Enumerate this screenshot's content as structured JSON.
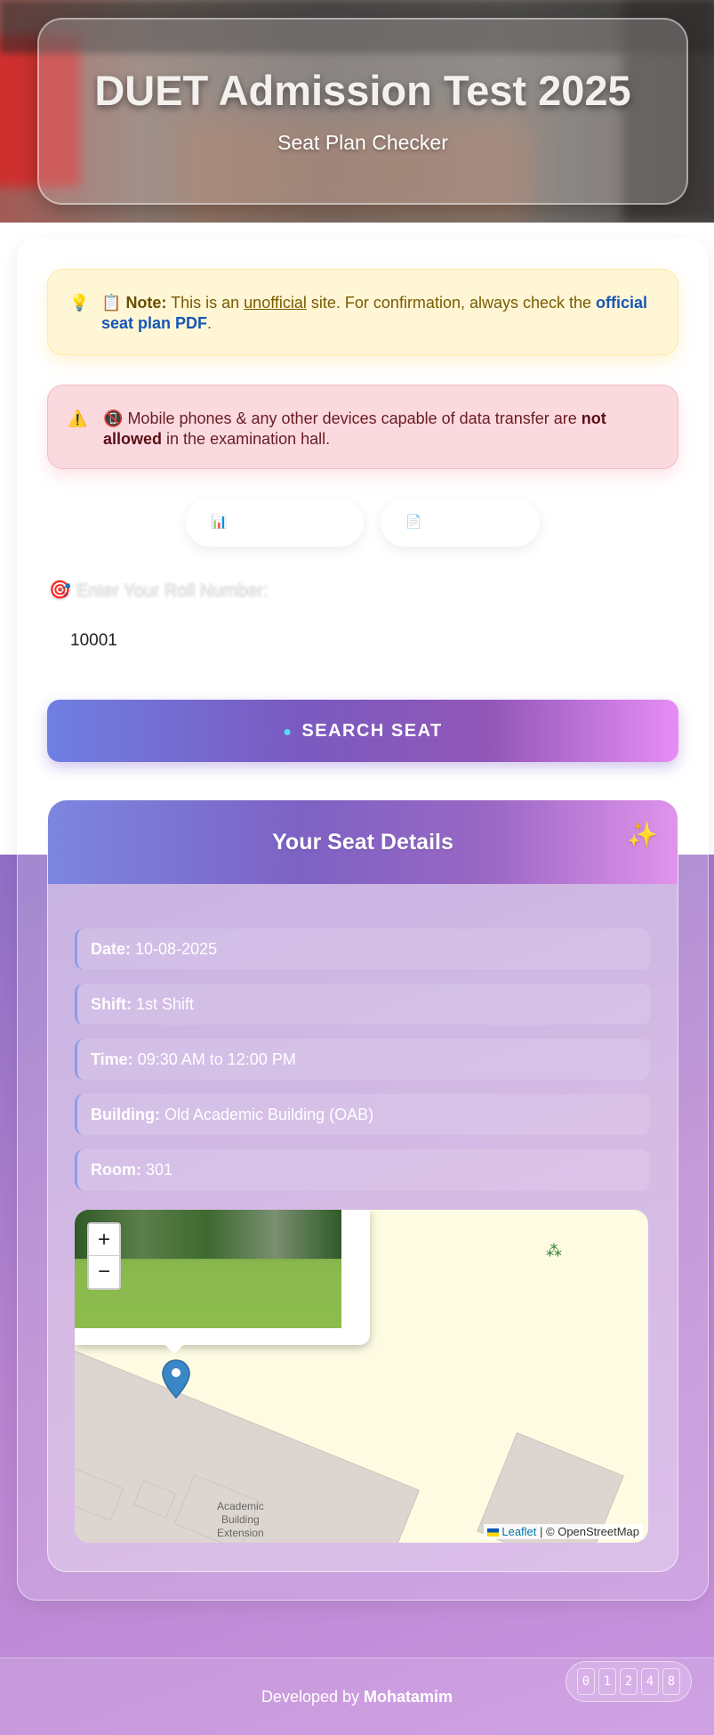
{
  "header": {
    "title": "DUET Admission Test 2025",
    "subtitle": "Seat Plan Checker"
  },
  "note": {
    "icon": "lightbulb-icon",
    "prefix_icon": "clipboard-icon",
    "label": "Note:",
    "text_before": "This is an",
    "unofficial": "unofficial",
    "text_middle": "site. For confirmation, always check the",
    "link": "official seat plan PDF",
    "end": "."
  },
  "warning": {
    "icon": "warning-icon",
    "prefix_icon": "no-phone-icon",
    "text_before": "Mobile phones & any other devices capable of data transfer are",
    "bold": "not allowed",
    "text_after": "in the examination hall."
  },
  "pills": [
    {
      "icon": "chart-icon",
      "label": ""
    },
    {
      "icon": "document-icon",
      "label": ""
    }
  ],
  "form": {
    "label": "Enter Your Roll Number:",
    "label_icon": "target-icon",
    "value": "10001"
  },
  "search_button": {
    "label": "SEARCH SEAT",
    "icon": "search-icon"
  },
  "result": {
    "title": "Your Seat Details",
    "rows": [
      {
        "label": "Date:",
        "value": "10-08-2025"
      },
      {
        "label": "Shift:",
        "value": "1st Shift"
      },
      {
        "label": "Time:",
        "value": "09:30 AM to 12:00 PM"
      },
      {
        "label": "Building:",
        "value": "Old Academic Building (OAB)"
      },
      {
        "label": "Room:",
        "value": "301"
      }
    ]
  },
  "map": {
    "zoom_in": "+",
    "zoom_out": "−",
    "place_label_1": "Academic",
    "place_label_2": "Building",
    "place_label_3": "Extension",
    "attribution_leaflet": "Leaflet",
    "attribution_rest": "| © OpenStreetMap"
  },
  "footer": {
    "prefix": "Developed by",
    "author": "Mohatamim"
  },
  "counter": [
    "0",
    "1",
    "2",
    "4",
    "8"
  ]
}
